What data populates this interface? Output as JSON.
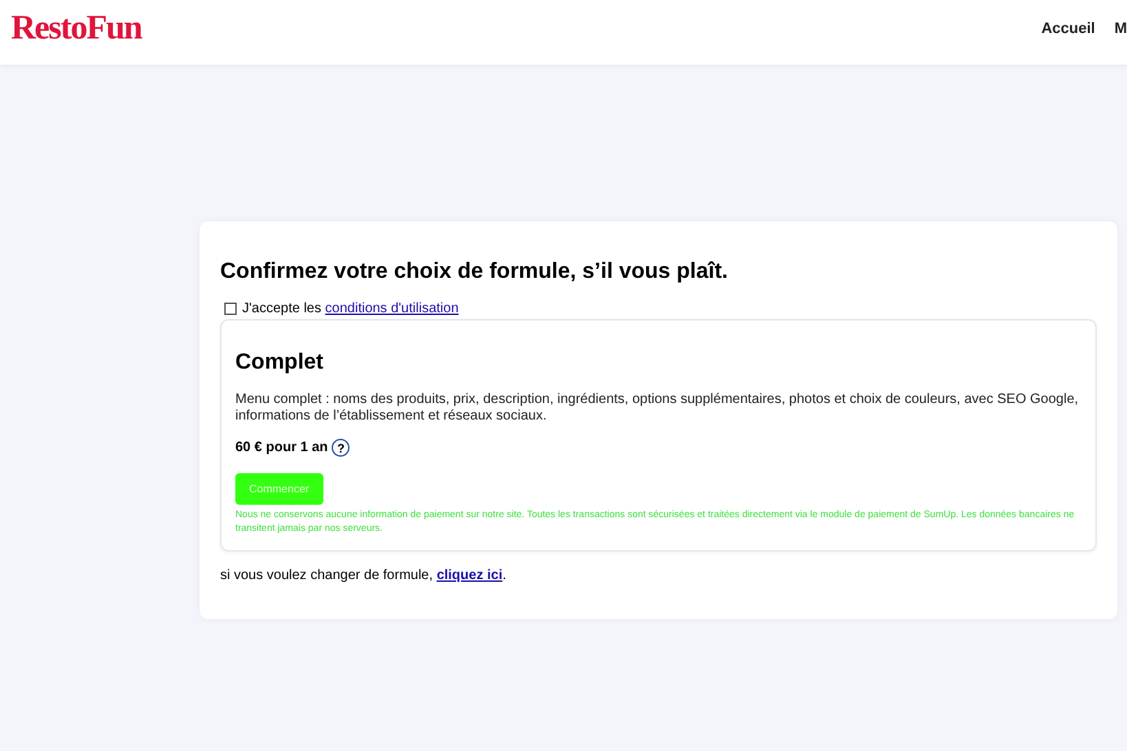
{
  "header": {
    "logo": "RestoFun",
    "nav": [
      {
        "label": "Accueil"
      },
      {
        "label": "M"
      }
    ]
  },
  "confirm": {
    "title": "Confirmez votre choix de formule, s’il vous plaît.",
    "terms": {
      "checked": false,
      "text": "J'accepte les ",
      "link": "conditions d'utilisation"
    },
    "plan": {
      "name": "Complet",
      "description": "Menu complet : noms des produits, prix, description, ingrédients, options supplémentaires, photos et choix de couleurs, avec SEO Google, informations de l’établissement et réseaux sociaux.",
      "price": "60 € pour 1 an",
      "help": "?",
      "button": "Commencer",
      "notice": "Nous ne conservons aucune information de paiement sur notre site. Toutes les transactions sont sécurisées et traitées directement via le module de paiement de SumUp. Les données bancaires ne transitent jamais par nos serveurs."
    },
    "change": {
      "text": "si vous voulez changer de formule, ",
      "link": "cliquez ici",
      "after": "."
    }
  }
}
